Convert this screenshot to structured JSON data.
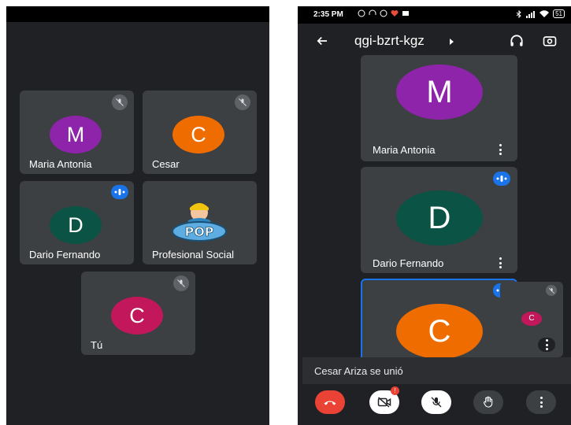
{
  "left": {
    "tiles": [
      {
        "name": "Maria Antonia",
        "initial": "M",
        "color": "#8e24aa",
        "status": "muted"
      },
      {
        "name": "Cesar",
        "initial": "C",
        "color": "#ef6c00",
        "status": "muted"
      },
      {
        "name": "Dario Fernando",
        "initial": "D",
        "color": "#0b5345",
        "status": "speaking"
      },
      {
        "name": "Profesional Social",
        "logo_text": "POP",
        "status": "none"
      },
      {
        "name": "Tú",
        "initial": "C",
        "color": "#c2185b",
        "status": "muted"
      }
    ]
  },
  "right": {
    "status_bar": {
      "time": "2:35 PM",
      "battery": "51"
    },
    "meeting_code": "qgi-bzrt-kgz",
    "tiles": [
      {
        "name": "Maria Antonia",
        "initial": "M",
        "color": "#8e24aa"
      },
      {
        "name": "Dario Fernando",
        "initial": "D",
        "color": "#0b5345",
        "status": "speaking"
      },
      {
        "name": "",
        "initial": "C",
        "color": "#ef6c00",
        "status": "speaking"
      }
    ],
    "self_view": {
      "initial": "C",
      "color": "#c2185b"
    },
    "toast": "Cesar Ariza se unió",
    "controls": {
      "end_call_color": "#ea4335",
      "camera_badge": "!"
    }
  },
  "icons": [
    "back-arrow-icon",
    "headphones-icon",
    "switch-camera-icon",
    "mic-off-icon",
    "audio-wave-icon",
    "more-vert-icon",
    "end-call-icon",
    "camera-off-icon",
    "raise-hand-icon"
  ]
}
